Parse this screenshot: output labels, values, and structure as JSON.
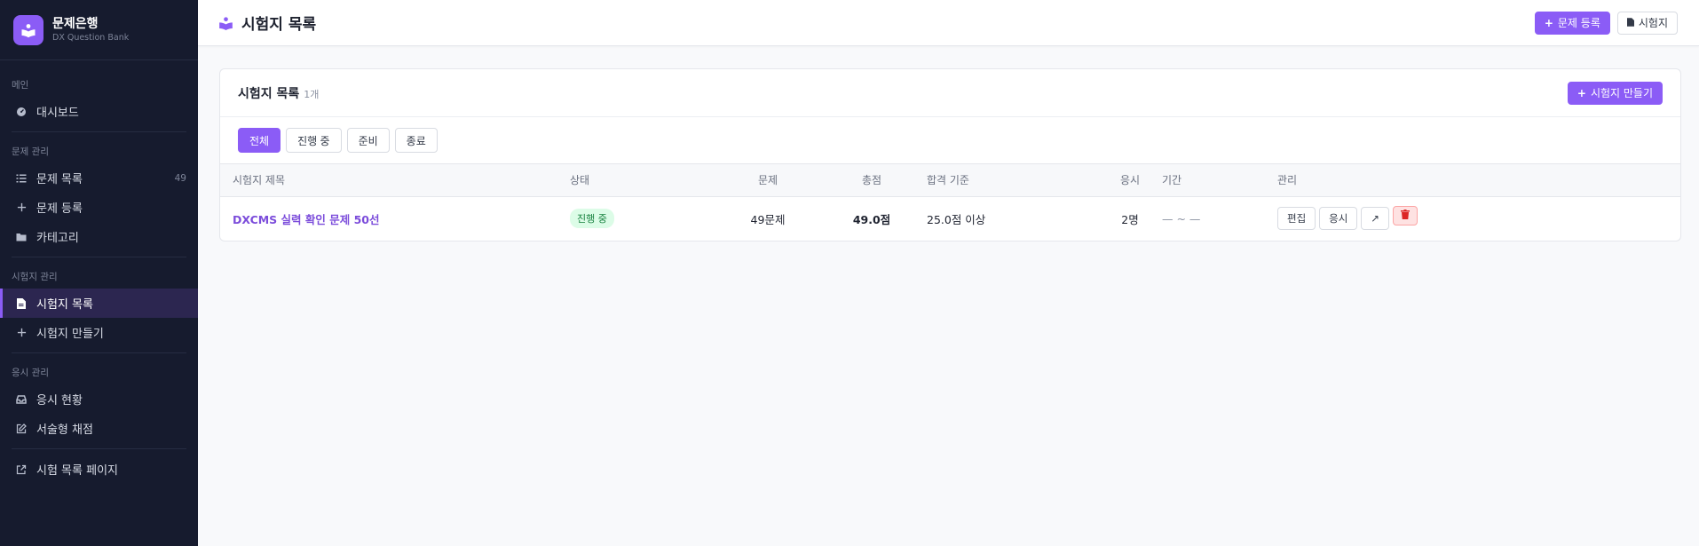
{
  "brand": {
    "title": "문제은행",
    "subtitle": "DX Question Bank"
  },
  "sidebar": {
    "sections": [
      {
        "title": "메인",
        "items": [
          {
            "label": "대시보드",
            "icon": "dashboard-icon"
          }
        ]
      },
      {
        "title": "문제 관리",
        "items": [
          {
            "label": "문제 목록",
            "icon": "list-icon",
            "badge": "49"
          },
          {
            "label": "문제 등록",
            "icon": "plus-icon"
          },
          {
            "label": "카테고리",
            "icon": "folder-icon"
          }
        ]
      },
      {
        "title": "시험지 관리",
        "items": [
          {
            "label": "시험지 목록",
            "icon": "document-icon",
            "active": true
          },
          {
            "label": "시험지 만들기",
            "icon": "plus-icon"
          }
        ]
      },
      {
        "title": "응시 관리",
        "items": [
          {
            "label": "응시 현황",
            "icon": "inbox-icon"
          },
          {
            "label": "서술형 채점",
            "icon": "edit-icon"
          }
        ]
      },
      {
        "title": "",
        "items": [
          {
            "label": "시험 목록 페이지",
            "icon": "external-link-icon"
          }
        ]
      }
    ]
  },
  "topbar": {
    "title": "시험지 목록",
    "add_question_label": "문제 등록",
    "exam_label": "시험지"
  },
  "card": {
    "title": "시험지 목록",
    "count": "1개",
    "create_label": "시험지 만들기"
  },
  "filters": [
    {
      "label": "전체",
      "active": true
    },
    {
      "label": "진행 중"
    },
    {
      "label": "준비"
    },
    {
      "label": "종료"
    }
  ],
  "table": {
    "headers": {
      "title": "시험지 제목",
      "status": "상태",
      "questions": "문제",
      "score": "총점",
      "pass": "합격 기준",
      "applicants": "응시",
      "period": "기간",
      "manage": "관리"
    },
    "rows": [
      {
        "title": "DXCMS 실력 확인 문제 50선",
        "status": "진행 중",
        "questions": "49문제",
        "score": "49.0점",
        "pass": "25.0점 이상",
        "applicants": "2명",
        "period": "— ~ —",
        "edit_label": "편집",
        "take_label": "응시",
        "open_label": "↗"
      }
    ]
  },
  "colors": {
    "accent": "#8b5cf6",
    "sidebar_bg": "#161b2e",
    "status_green": "#15803d",
    "danger": "#dc2626"
  }
}
